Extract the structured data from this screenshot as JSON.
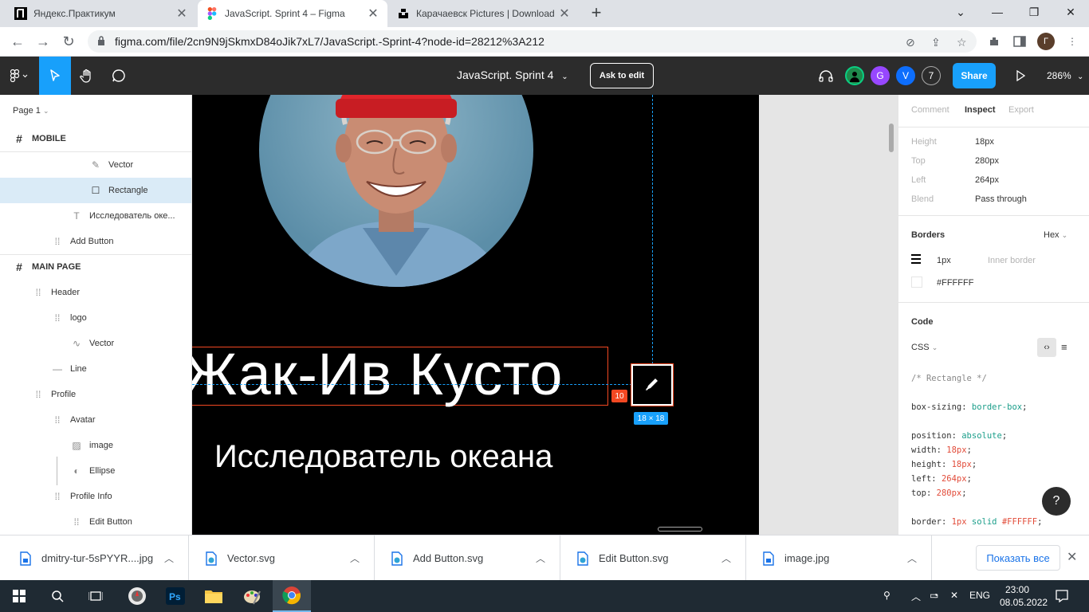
{
  "browser": {
    "tabs": [
      {
        "title": "Яндекс.Практикум",
        "active": false
      },
      {
        "title": "JavaScript. Sprint 4 – Figma",
        "active": true
      },
      {
        "title": "Карачаевск Pictures | Download",
        "active": false
      }
    ],
    "url": "figma.com/file/2cn9N9jSkmxD84oJik7xL7/JavaScript.-Sprint-4?node-id=28212%3A212",
    "profile_initial": "Г"
  },
  "figma": {
    "doc_title": "JavaScript. Sprint 4",
    "ask_to_edit": "Ask to edit",
    "share": "Share",
    "zoom": "286%",
    "avatars": [
      {
        "initial": "",
        "color": "#1f8a4c"
      },
      {
        "initial": "G",
        "color": "#9747ff"
      },
      {
        "initial": "V",
        "color": "#0d6efd"
      },
      {
        "initial": "7",
        "color": "#2c2c2c"
      }
    ]
  },
  "layers": {
    "page": "Page 1",
    "items": [
      {
        "label": "MOBILE",
        "icon": "frame-icon",
        "frame": true
      },
      {
        "label": "Vector",
        "icon": "pen-icon"
      },
      {
        "label": "Rectangle",
        "icon": "rectangle-icon",
        "highlighted": true
      },
      {
        "label": "Исследователь оке...",
        "icon": "text-icon"
      },
      {
        "label": "Add Button",
        "icon": "group-icon"
      },
      {
        "label": "MAIN PAGE",
        "icon": "frame-icon",
        "frame": true
      },
      {
        "label": "Header",
        "icon": "group-icon"
      },
      {
        "label": "logo",
        "icon": "group-icon"
      },
      {
        "label": "Vector",
        "icon": "vector-icon"
      },
      {
        "label": "Line",
        "icon": "line-icon"
      },
      {
        "label": "Profile",
        "icon": "group-icon"
      },
      {
        "label": "Avatar",
        "icon": "group-icon"
      },
      {
        "label": "image",
        "icon": "image-icon"
      },
      {
        "label": "Ellipse",
        "icon": "ellipse-icon"
      },
      {
        "label": "Profile Info",
        "icon": "group-icon"
      },
      {
        "label": "Edit Button",
        "icon": "group-icon"
      }
    ]
  },
  "canvas": {
    "name": "Жак-Ив Кусто",
    "subtitle": "Исследователь океана",
    "distance": "10",
    "size": "18 × 18"
  },
  "inspect": {
    "tabs": [
      "Comment",
      "Inspect",
      "Export"
    ],
    "active_tab": "Inspect",
    "props": [
      {
        "key": "Height",
        "value": "18px"
      },
      {
        "key": "Top",
        "value": "280px"
      },
      {
        "key": "Left",
        "value": "264px"
      },
      {
        "key": "Blend",
        "value": "Pass through"
      }
    ],
    "borders_title": "Borders",
    "color_format": "Hex",
    "border_width": "1px",
    "border_type": "Inner border",
    "border_color": "#FFFFFF",
    "code_title": "Code",
    "code_lang": "CSS",
    "code": {
      "comment": "/* Rectangle */",
      "box_sizing_prop": "box-sizing",
      "box_sizing_val": "border-box",
      "position_prop": "position",
      "position_val": "absolute",
      "width_prop": "width",
      "width_val": "18px",
      "height_prop": "height",
      "height_val": "18px",
      "left_prop": "left",
      "left_val": "264px",
      "top_prop": "top",
      "top_val": "280px",
      "border_prop": "border",
      "border_w": "1px",
      "border_style": "solid",
      "border_color": "#FFFFFF"
    }
  },
  "downloads": {
    "items": [
      {
        "name": "dmitry-tur-5sPYYR....jpg",
        "icon": "image-file-icon"
      },
      {
        "name": "Vector.svg",
        "icon": "edge-file-icon"
      },
      {
        "name": "Add Button.svg",
        "icon": "edge-file-icon"
      },
      {
        "name": "Edit Button.svg",
        "icon": "edge-file-icon"
      },
      {
        "name": "image.jpg",
        "icon": "image-file-icon"
      }
    ],
    "show_all": "Показать все"
  },
  "taskbar": {
    "lang": "ENG",
    "time": "23:00",
    "date": "08.05.2022"
  },
  "colors": {
    "figma_blue": "#18a0fb",
    "selection_red": "#f24822",
    "toolbar": "#2c2c2c"
  }
}
